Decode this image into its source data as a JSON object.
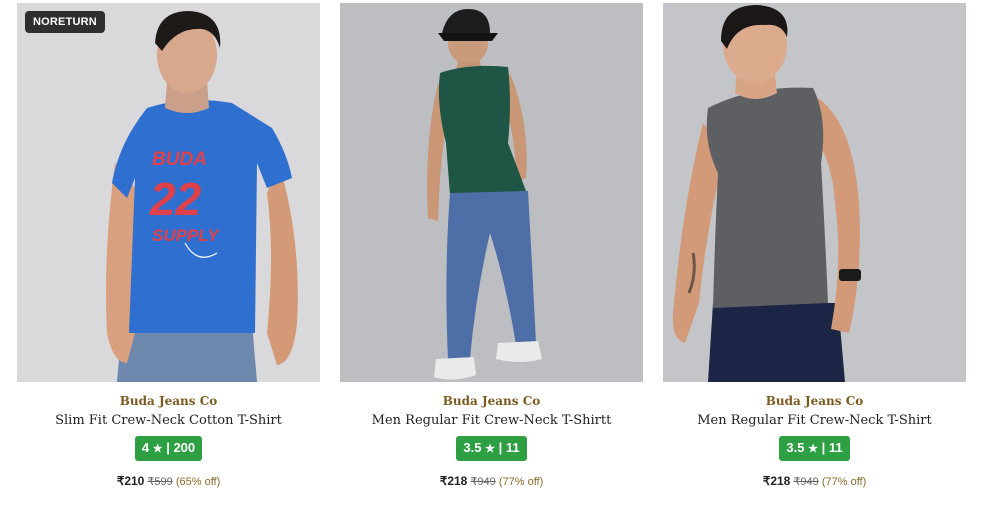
{
  "products": [
    {
      "badge": "NORETURN",
      "brand": "Buda Jeans Co",
      "title": "Slim Fit Crew-Neck Cotton T-Shirt",
      "rating": "4",
      "star": "★",
      "reviews": "| 200",
      "price": "₹210",
      "mrp": "₹599",
      "discount": "(65% off)",
      "image_icon": "model-blue-graphic-tshirt",
      "print_text": [
        "BUDA",
        "22",
        "SUPPLY"
      ]
    },
    {
      "brand": "Buda Jeans Co",
      "title": "Men Regular Fit Crew-Neck T-Shirtt",
      "rating": "3.5",
      "star": "★",
      "reviews": "| 11",
      "price": "₹218",
      "mrp": "₹949",
      "discount": "(77% off)",
      "image_icon": "model-green-sleeveless-tshirt"
    },
    {
      "brand": "Buda Jeans Co",
      "title": "Men Regular Fit Crew-Neck T-Shirt",
      "rating": "3.5",
      "star": "★",
      "reviews": "| 11",
      "price": "₹218",
      "mrp": "₹949",
      "discount": "(77% off)",
      "image_icon": "model-grey-sleeveless-tshirt"
    }
  ],
  "colors": {
    "brand_text": "#7a5a1e",
    "rating_bg": "#2ea043",
    "discount_text": "#8a6a2a",
    "badge_bg": "#2f2f2f"
  }
}
